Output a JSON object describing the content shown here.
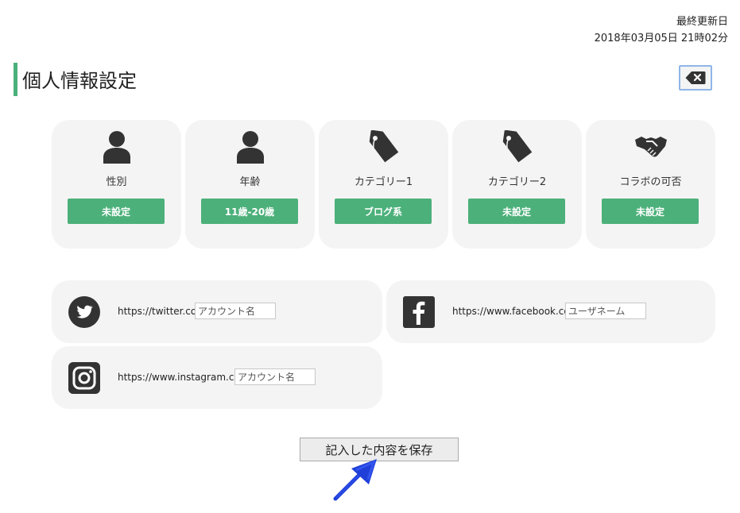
{
  "updated": {
    "label": "最終更新日",
    "datetime": "2018年03月05日 21時02分"
  },
  "page_title": "個人情報設定",
  "close_icon": "backspace-x-icon",
  "colors": {
    "accent": "#4cb07a",
    "panel": "#f4f4f4",
    "icon": "#333333"
  },
  "cards": [
    {
      "label": "性別",
      "value": "未設定",
      "icon": "person-icon"
    },
    {
      "label": "年齢",
      "value": "11歳-20歳",
      "icon": "person-icon"
    },
    {
      "label": "カテゴリー1",
      "value": "ブログ系",
      "icon": "tag-icon"
    },
    {
      "label": "カテゴリー2",
      "value": "未設定",
      "icon": "tag-icon"
    },
    {
      "label": "コラボの可否",
      "value": "未設定",
      "icon": "handshake-icon"
    }
  ],
  "sns": {
    "twitter": {
      "url": "https://twitter.com/",
      "placeholder": "アカウント名",
      "icon": "twitter-icon"
    },
    "facebook": {
      "url": "https://www.facebook.com/",
      "placeholder": "ユーザネーム",
      "icon": "facebook-icon"
    },
    "instagram": {
      "url": "https://www.instagram.com/",
      "placeholder": "アカウント名",
      "icon": "instagram-icon"
    }
  },
  "save_label": "記入した内容を保存",
  "arrow_icon": "hand-drawn-arrow-icon"
}
